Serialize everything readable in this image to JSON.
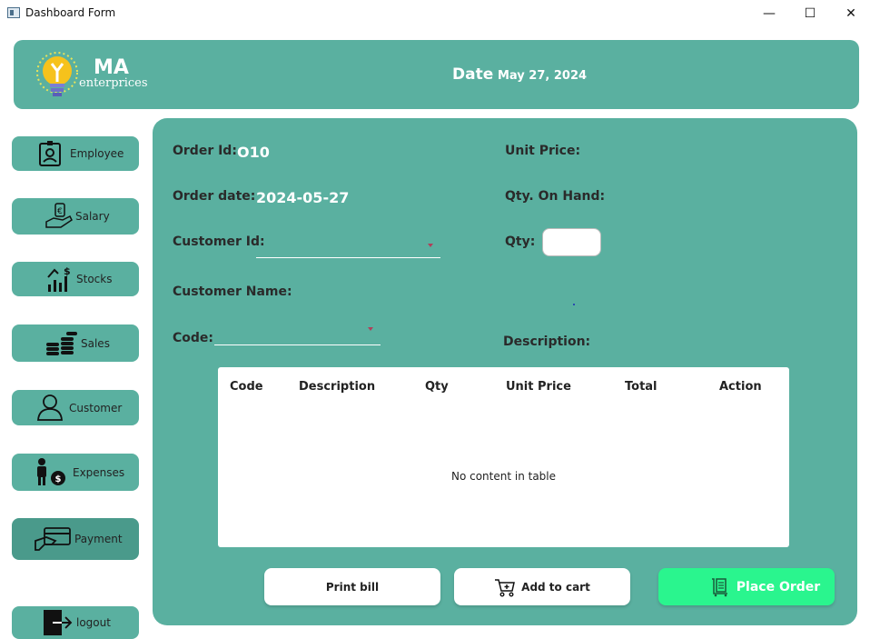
{
  "window": {
    "title": "Dashboard Form",
    "minimize": "—",
    "maximize": "☐",
    "close": "✕"
  },
  "header": {
    "brand_main": "MA",
    "brand_sub": "enterprices",
    "date_label": "Date",
    "date_value": "May 27, 2024"
  },
  "sidebar": {
    "items": [
      {
        "label": "Employee",
        "icon": "employee-badge-icon"
      },
      {
        "label": "Salary",
        "icon": "salary-hand-icon"
      },
      {
        "label": "Stocks",
        "icon": "stocks-chart-icon"
      },
      {
        "label": "Sales",
        "icon": "coins-stack-icon"
      },
      {
        "label": "Customer",
        "icon": "customer-person-icon"
      },
      {
        "label": "Expenses",
        "icon": "expenses-person-icon"
      },
      {
        "label": "Payment",
        "icon": "payment-card-icon"
      },
      {
        "label": "logout",
        "icon": "logout-icon"
      }
    ]
  },
  "form": {
    "order_id_label": "Order Id:",
    "order_id_value": "O10",
    "order_date_label": "Order date:",
    "order_date_value": "2024-05-27",
    "customer_id_label": "Customer Id:",
    "customer_id_value": "",
    "customer_name_label": "Customer Name:",
    "code_label": "Code:",
    "code_value": "",
    "unit_price_label": "Unit Price:",
    "qty_on_hand_label": "Qty. On Hand:",
    "qty_label": "Qty:",
    "qty_value": "",
    "description_label": "Description:"
  },
  "table": {
    "columns": [
      "Code",
      "Description",
      "Qty",
      "Unit Price",
      "Total",
      "Action"
    ],
    "rows": [],
    "empty_text": "No content in table"
  },
  "actions": {
    "print_bill": "Print bill",
    "add_to_cart": "Add to cart",
    "place_order": "Place Order"
  },
  "colors": {
    "panel": "#5ab0a0",
    "active": "#4a9a8b",
    "place_order": "#2af58e",
    "text_dark": "#2a2a2a"
  }
}
